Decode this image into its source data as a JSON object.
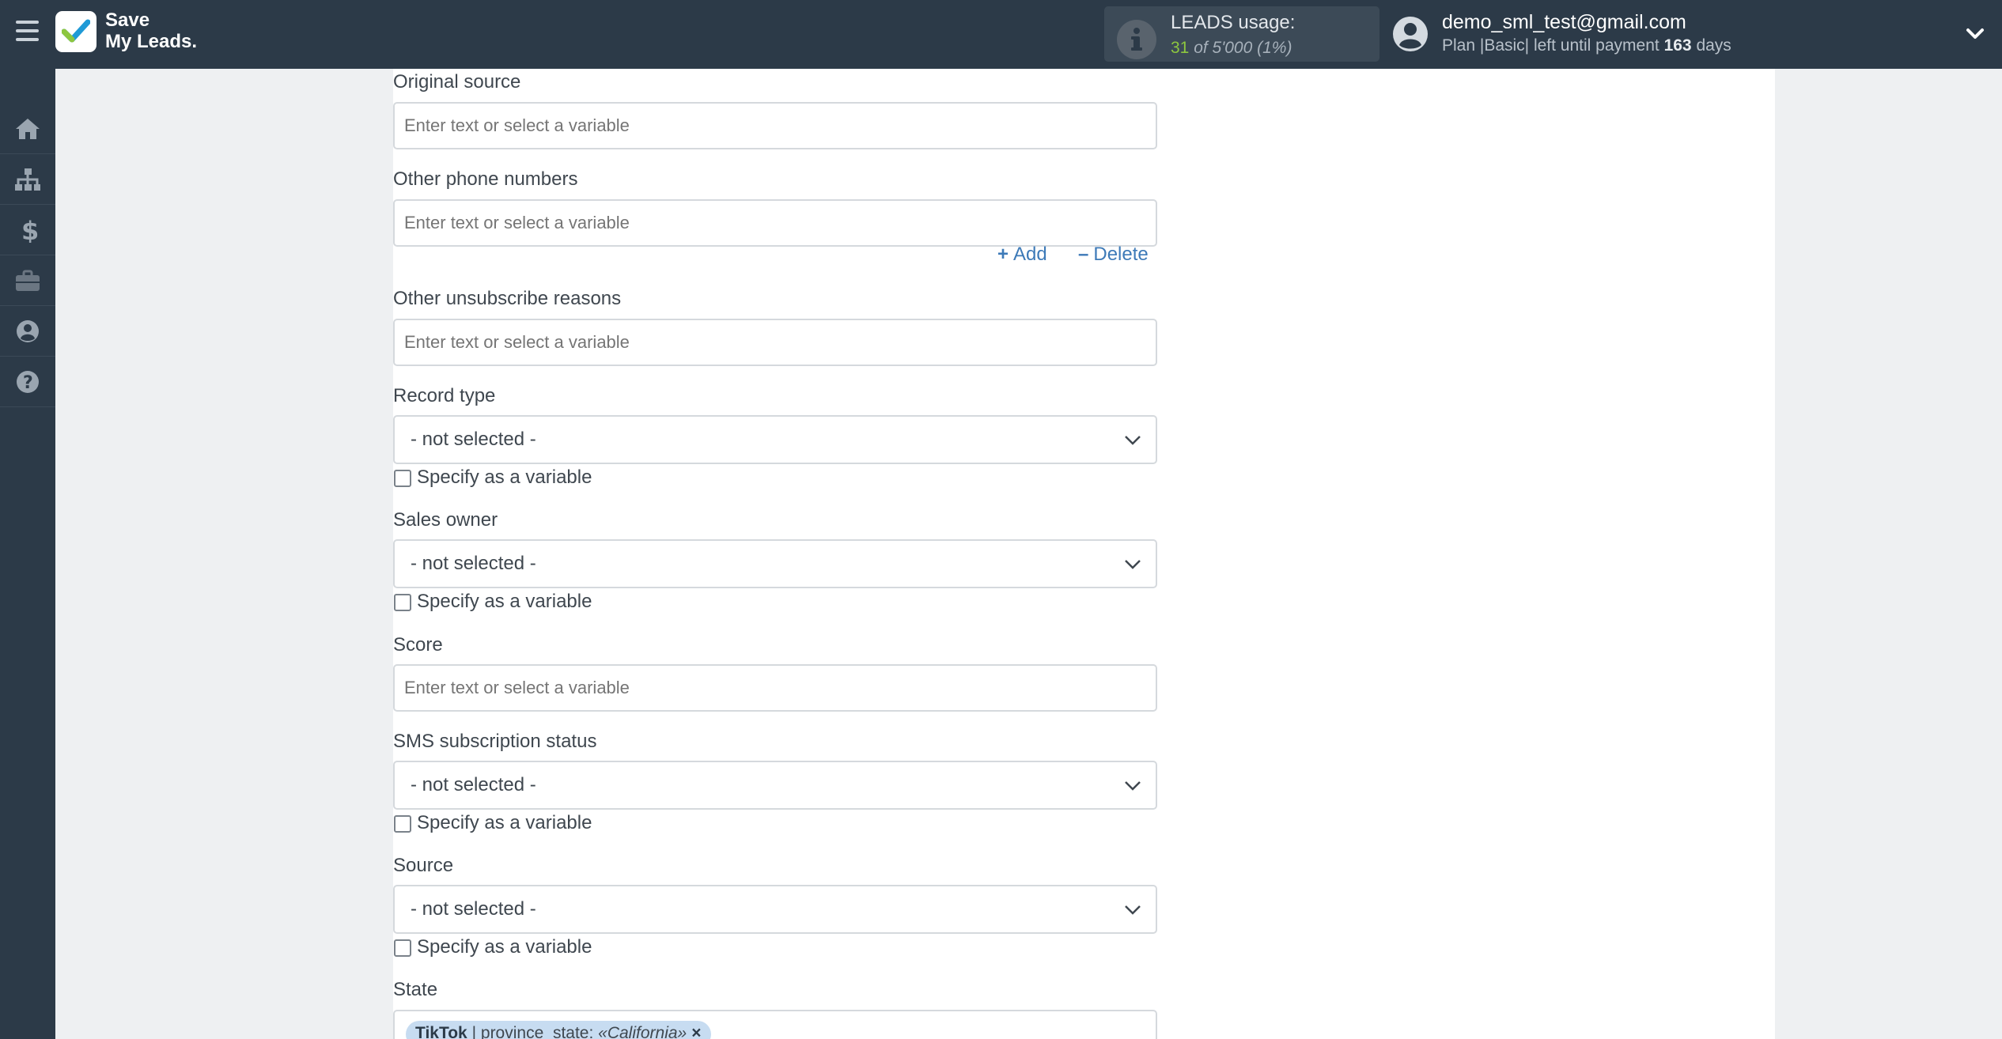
{
  "header": {
    "logo_line1": "Save",
    "logo_line2": "My Leads.",
    "usage_title": "LEADS usage:",
    "usage_used": "31",
    "usage_rest": "of 5'000 (1%)",
    "user_email": "demo_sml_test@gmail.com",
    "plan_prefix": "Plan |Basic| left until payment",
    "plan_days": "163",
    "plan_suffix": "days"
  },
  "sidebar": {
    "items": [
      "home-icon",
      "sitemap-icon",
      "dollar-icon",
      "briefcase-icon",
      "user-icon",
      "help-icon"
    ]
  },
  "form": {
    "original_source": {
      "label": "Original source",
      "placeholder": "Enter text or select a variable"
    },
    "other_phone_numbers": {
      "label": "Other phone numbers",
      "placeholder": "Enter text or select a variable"
    },
    "add_label": "Add",
    "delete_label": "Delete",
    "other_unsubscribe_reasons": {
      "label": "Other unsubscribe reasons",
      "placeholder": "Enter text or select a variable"
    },
    "record_type": {
      "label": "Record type",
      "value": "- not selected -",
      "checkbox": "Specify as a variable"
    },
    "sales_owner": {
      "label": "Sales owner",
      "value": "- not selected -",
      "checkbox": "Specify as a variable"
    },
    "score": {
      "label": "Score",
      "placeholder": "Enter text or select a variable"
    },
    "sms_subscription_status": {
      "label": "SMS subscription status",
      "value": "- not selected -",
      "checkbox": "Specify as a variable"
    },
    "source": {
      "label": "Source",
      "value": "- not selected -",
      "checkbox": "Specify as a variable"
    },
    "state": {
      "label": "State",
      "tag_source": "TikTok",
      "tag_field": "| province_state:",
      "tag_value": "«California»",
      "tag_remove": "×"
    }
  },
  "colors": {
    "topbar": "#2c3a48",
    "accent_green": "#8dc63f",
    "link_blue": "#3d7ab8",
    "tag_bg": "#c7dcf1"
  }
}
